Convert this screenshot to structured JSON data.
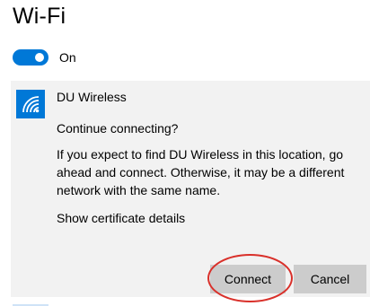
{
  "header": {
    "title": "Wi-Fi"
  },
  "wifi_toggle": {
    "state_label": "On",
    "is_on": true
  },
  "network": {
    "name": "DU Wireless",
    "icon": "wifi-signal-icon",
    "prompt": "Continue connecting?",
    "description": "If you expect to find DU Wireless in this location, go ahead and connect. Otherwise, it may be a different network with the same name.",
    "cert_link": "Show certificate details"
  },
  "buttons": {
    "connect_label": "Connect",
    "cancel_label": "Cancel"
  },
  "colors": {
    "accent": "#0078d7",
    "panel_bg": "#f2f2f2",
    "button_bg": "#cccccc",
    "annotation": "#d9302a"
  }
}
